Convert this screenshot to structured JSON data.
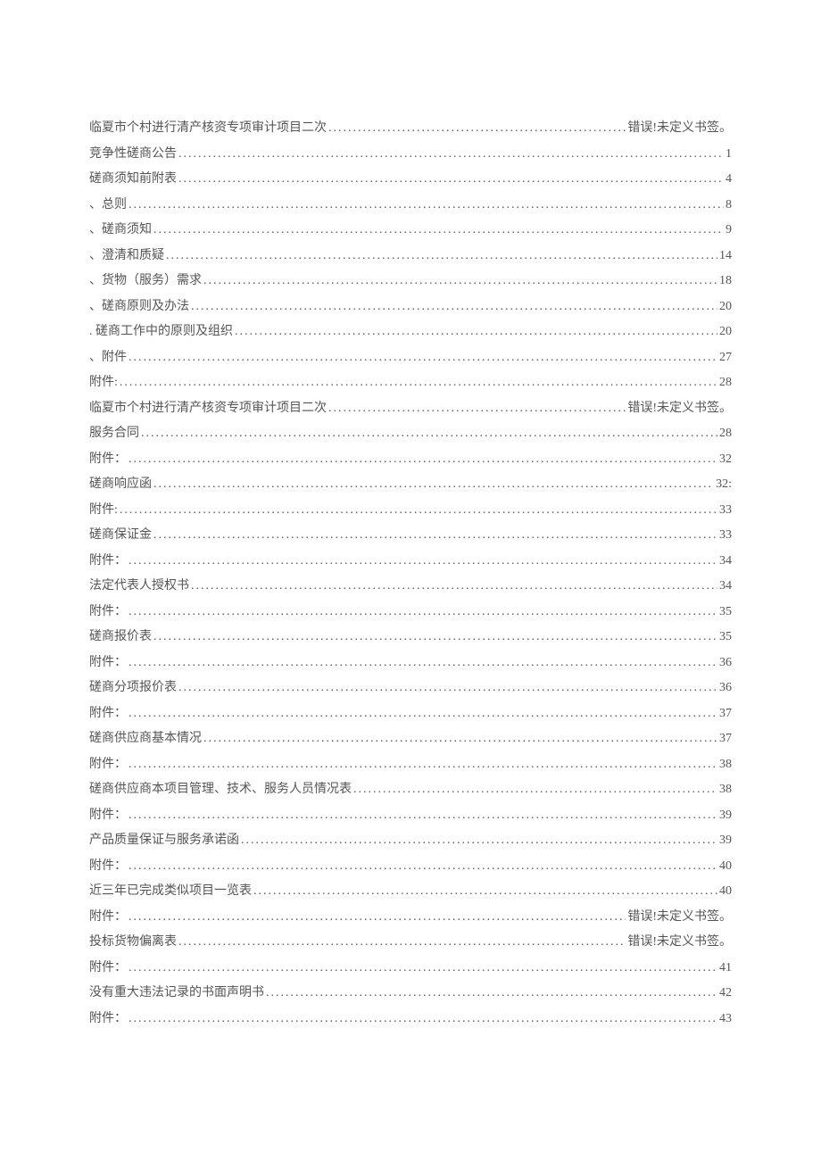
{
  "toc": [
    {
      "title": "临夏市个村进行清产核资专项审计项目二次",
      "page": "错误!未定义书签。"
    },
    {
      "title": "竞争性磋商公告",
      "page": "1"
    },
    {
      "title": "磋商须知前附表",
      "page": "4"
    },
    {
      "title": "、总则",
      "page": "8"
    },
    {
      "title": "、磋商须知",
      "page": "9"
    },
    {
      "title": "、澄清和质疑",
      "page": "14"
    },
    {
      "title": "、货物（服务）需求",
      "page": "18"
    },
    {
      "title": "、磋商原则及办法",
      "page": "20"
    },
    {
      "title": ". 磋商工作中的原则及组织",
      "page": "20"
    },
    {
      "title": "、附件",
      "page": "27"
    },
    {
      "title": "附件:",
      "page": "28"
    },
    {
      "title": "临夏市个村进行清产核资专项审计项目二次",
      "page": "错误!未定义书签。"
    },
    {
      "title": "服务合同",
      "page": "28"
    },
    {
      "title": "附件：",
      "page": "32"
    },
    {
      "title": "磋商响应函",
      "page": "32:"
    },
    {
      "title": "附件:",
      "page": "33"
    },
    {
      "title": "磋商保证金",
      "page": "33"
    },
    {
      "title": "附件：",
      "page": "34"
    },
    {
      "title": "法定代表人授权书",
      "page": "34"
    },
    {
      "title": "附件：",
      "page": "35"
    },
    {
      "title": "磋商报价表",
      "page": "35"
    },
    {
      "title": "附件：",
      "page": "36"
    },
    {
      "title": "磋商分项报价表",
      "page": "36"
    },
    {
      "title": "附件：",
      "page": "37"
    },
    {
      "title": "磋商供应商基本情况",
      "page": "37"
    },
    {
      "title": "附件：",
      "page": "38"
    },
    {
      "title": "磋商供应商本项目管理、技术、服务人员情况表",
      "page": "38"
    },
    {
      "title": "附件：",
      "page": "39"
    },
    {
      "title": "产品质量保证与服务承诺函",
      "page": "39"
    },
    {
      "title": "附件：",
      "page": "40"
    },
    {
      "title": "近三年已完成类似项目一览表",
      "page": "40"
    },
    {
      "title": "附件：",
      "page": "错误!未定义书签。"
    },
    {
      "title": "投标货物偏离表",
      "page": "错误!未定义书签。"
    },
    {
      "title": "附件：",
      "page": "41"
    },
    {
      "title": "没有重大违法记录的书面声明书",
      "page": "42"
    },
    {
      "title": "附件：",
      "page": "43"
    }
  ]
}
